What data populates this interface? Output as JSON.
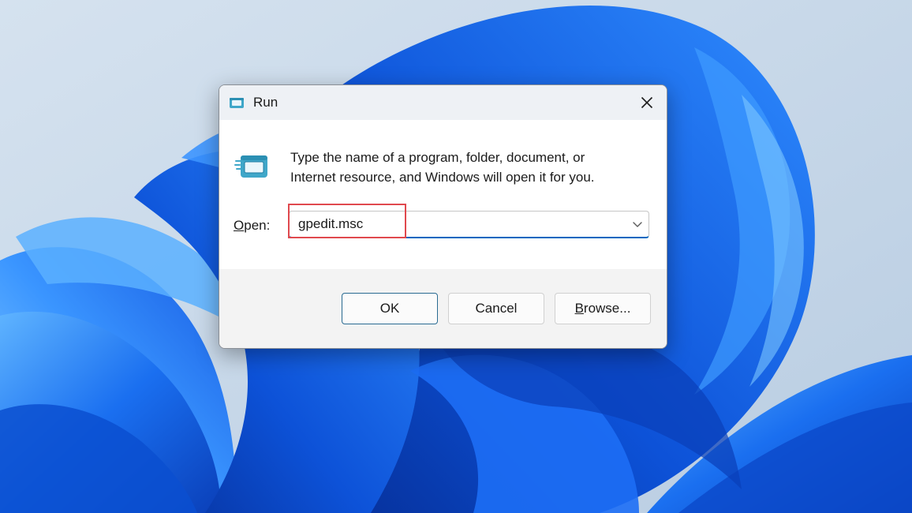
{
  "window": {
    "title": "Run",
    "title_icon": "run-app-icon",
    "close_icon": "close-icon"
  },
  "content": {
    "description_line1": "Type the name of a program, folder, document, or",
    "description_line2": "Internet resource, and Windows will open it for you.",
    "open_label_accel": "O",
    "open_label_rest": "pen:",
    "open_value": "gpedit.msc",
    "dropdown_icon": "chevron-down-icon"
  },
  "buttons": {
    "ok": "OK",
    "cancel": "Cancel",
    "browse_accel": "B",
    "browse_rest": "rowse..."
  },
  "colors": {
    "accent": "#0067c0",
    "highlight": "#e0494e",
    "wallpaper_blue": "#0a4fd6"
  }
}
